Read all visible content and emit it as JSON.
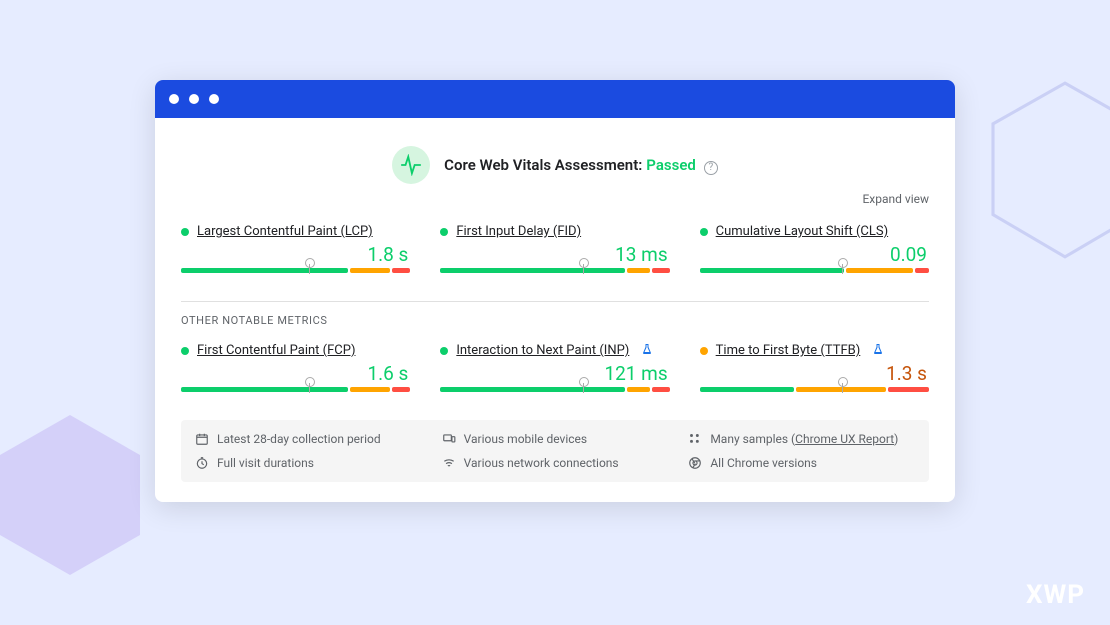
{
  "watermark": "XWP",
  "assessment": {
    "title_prefix": "Core Web Vitals Assessment:",
    "status": "Passed"
  },
  "expand_label": "Expand view",
  "section_other_label": "OTHER NOTABLE METRICS",
  "metrics_primary": [
    {
      "name": "Largest Contentful Paint (LCP)",
      "value": "1.8 s",
      "status": "good",
      "marker_pct": 56,
      "segments": [
        74,
        18,
        8
      ]
    },
    {
      "name": "First Input Delay (FID)",
      "value": "13 ms",
      "status": "good",
      "marker_pct": 62,
      "segments": [
        82,
        10,
        8
      ]
    },
    {
      "name": "Cumulative Layout Shift (CLS)",
      "value": "0.09",
      "status": "good",
      "marker_pct": 62,
      "segments": [
        64,
        30,
        6
      ]
    }
  ],
  "metrics_other": [
    {
      "name": "First Contentful Paint (FCP)",
      "value": "1.6 s",
      "status": "good",
      "experimental": false,
      "marker_pct": 56,
      "segments": [
        74,
        18,
        8
      ]
    },
    {
      "name": "Interaction to Next Paint (INP)",
      "value": "121 ms",
      "status": "good",
      "experimental": true,
      "marker_pct": 62,
      "segments": [
        82,
        10,
        8
      ]
    },
    {
      "name": "Time to First Byte (TTFB)",
      "value": "1.3 s",
      "status": "improve",
      "experimental": true,
      "marker_pct": 62,
      "segments": [
        42,
        40,
        18
      ]
    }
  ],
  "footer": {
    "collection": "Latest 28-day collection period",
    "durations": "Full visit durations",
    "devices": "Various mobile devices",
    "connections": "Various network connections",
    "samples_prefix": "Many samples (",
    "samples_link": "Chrome UX Report",
    "samples_suffix": ")",
    "versions": "All Chrome versions"
  },
  "colors": {
    "good": "#0cce6b",
    "improve": "#ffa400",
    "poor": "#ff4e42"
  }
}
